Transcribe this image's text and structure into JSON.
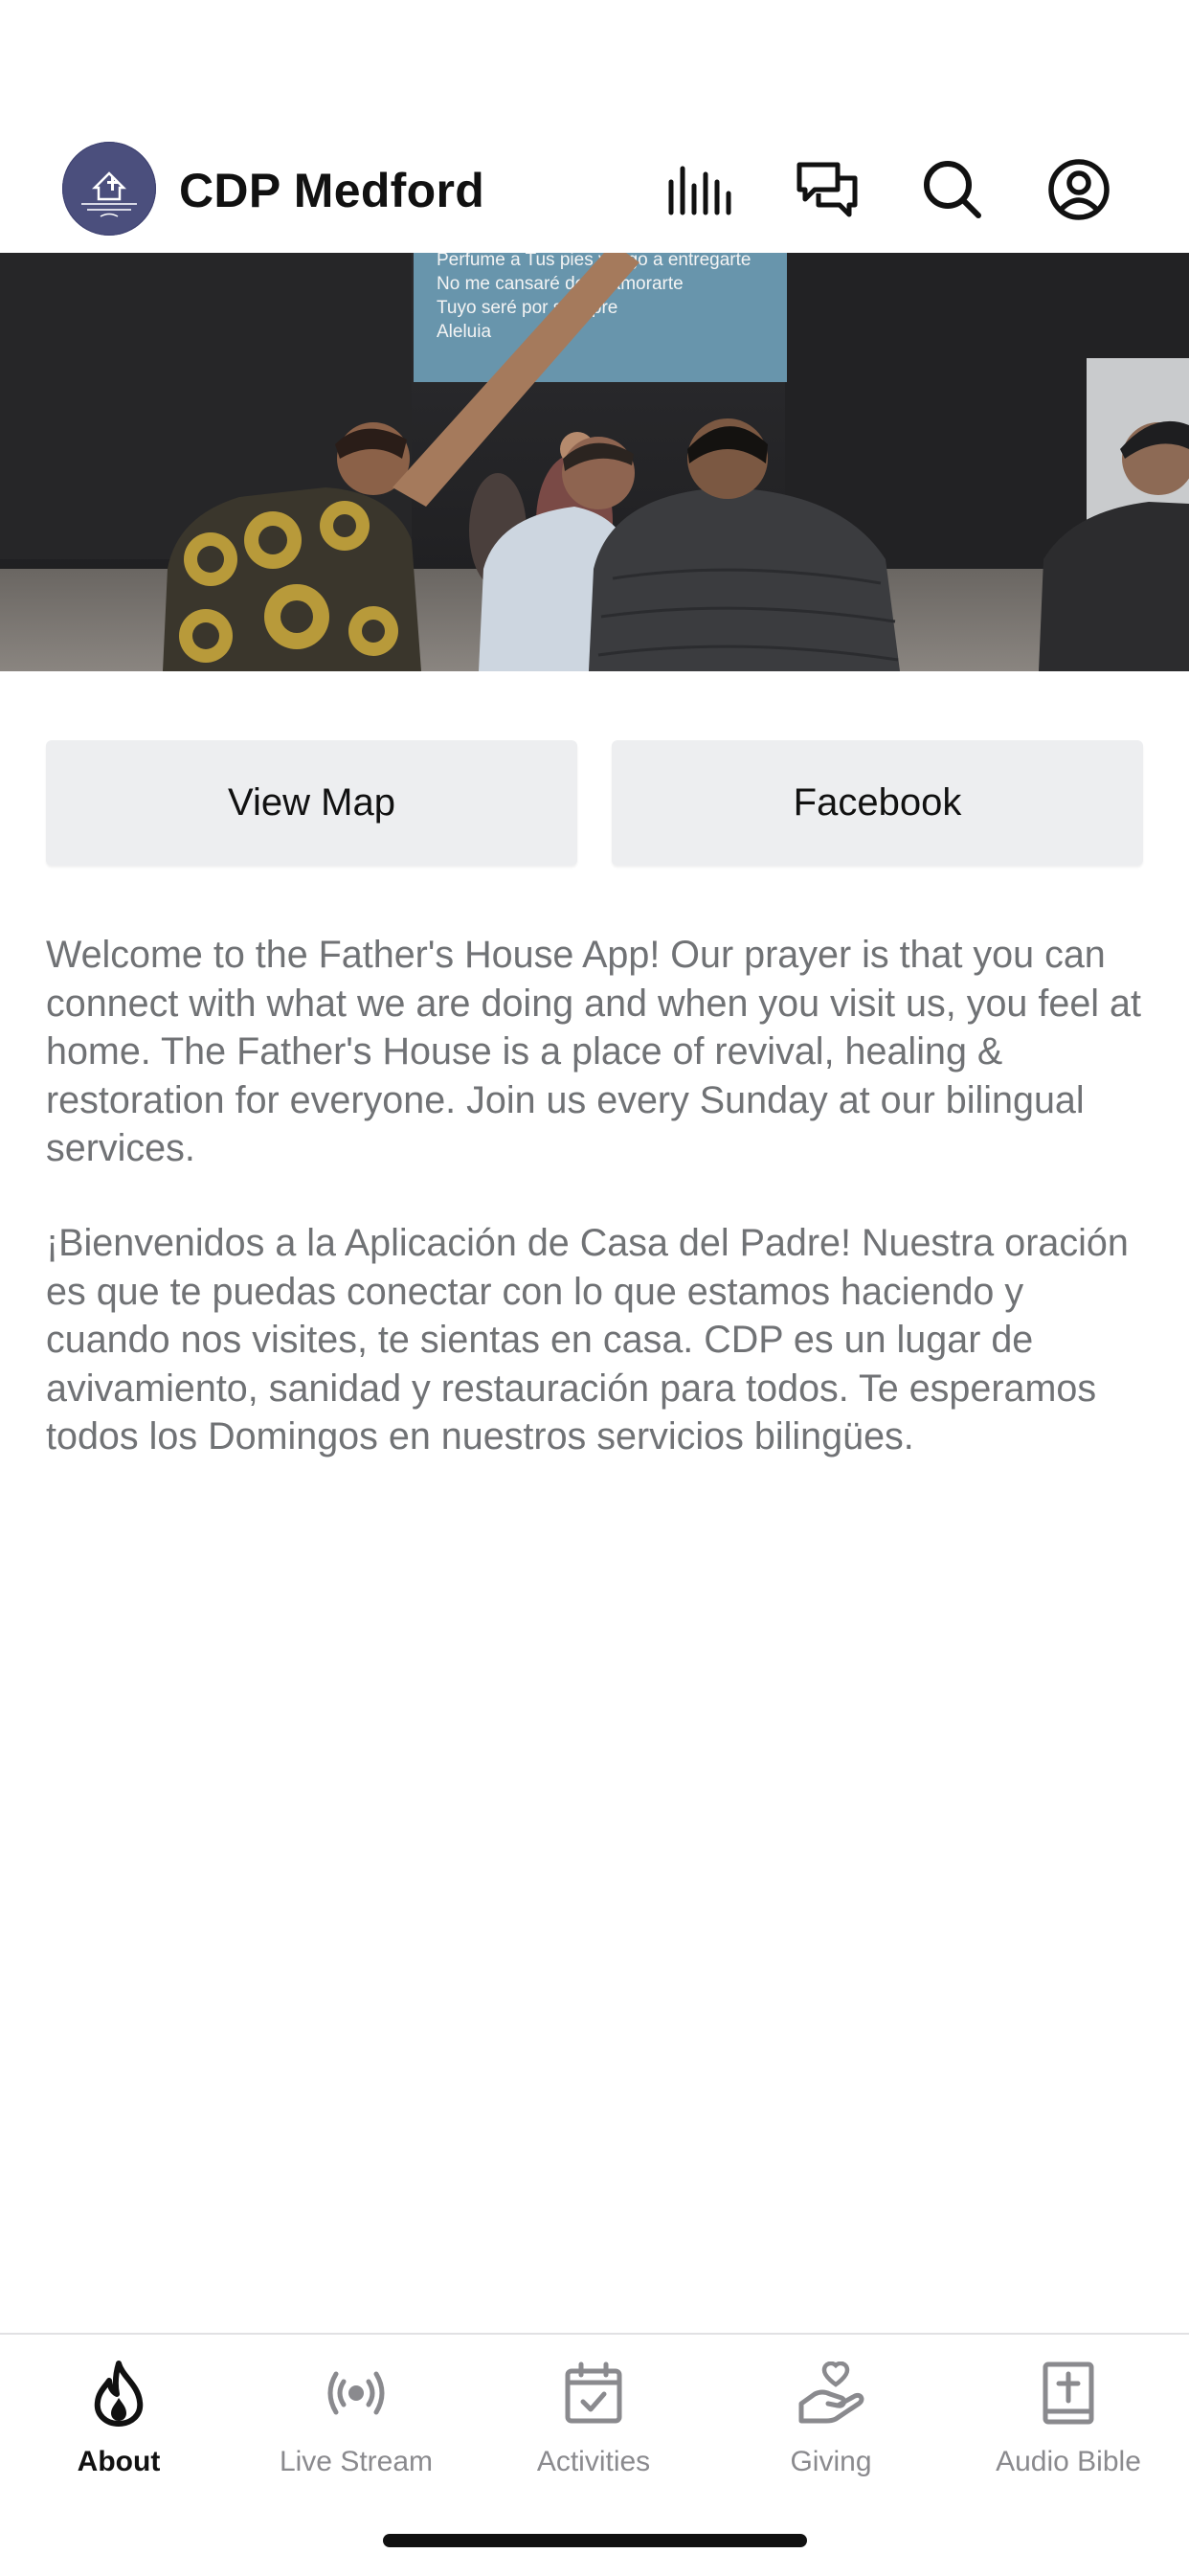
{
  "header": {
    "title": "CDP Medford",
    "logo_icon": "church-logo",
    "icons": [
      "audio-bars-icon",
      "chat-icon",
      "search-icon",
      "profile-icon"
    ]
  },
  "hero": {
    "slide_lines": [
      "Perfume a Tus pies vengo a entregarte",
      "No me cansaré de enamorarte",
      "Tuyo seré por siempre",
      "Aleluia"
    ]
  },
  "buttons": {
    "view_map": "View Map",
    "facebook": "Facebook"
  },
  "content": {
    "welcome_en": "Welcome to the Father's House App! Our prayer is that you can connect with what we are doing and when you visit us, you feel at home. The Father's House is a place of revival, healing & restoration for everyone. Join us every Sunday at our bilingual services.",
    "welcome_es": "¡Bienvenidos a la Aplicación de Casa del Padre! Nuestra oración es que te puedas conectar con lo que estamos haciendo y cuando nos visites, te sientas en casa. CDP es un lugar de avivamiento, sanidad y restauración para todos. Te esperamos todos los Domingos en nuestros servicios bilingües."
  },
  "tabs": [
    {
      "label": "About",
      "icon": "flame-icon",
      "active": true
    },
    {
      "label": "Live Stream",
      "icon": "broadcast-icon",
      "active": false
    },
    {
      "label": "Activities",
      "icon": "calendar-check-icon",
      "active": false
    },
    {
      "label": "Giving",
      "icon": "hand-heart-icon",
      "active": false
    },
    {
      "label": "Audio Bible",
      "icon": "bible-icon",
      "active": false
    }
  ],
  "colors": {
    "logo_bg": "#4b4f7d",
    "button_bg": "#edeef0",
    "body_text": "#707275",
    "tab_inactive": "#8a8a8e",
    "tab_active": "#111111"
  }
}
